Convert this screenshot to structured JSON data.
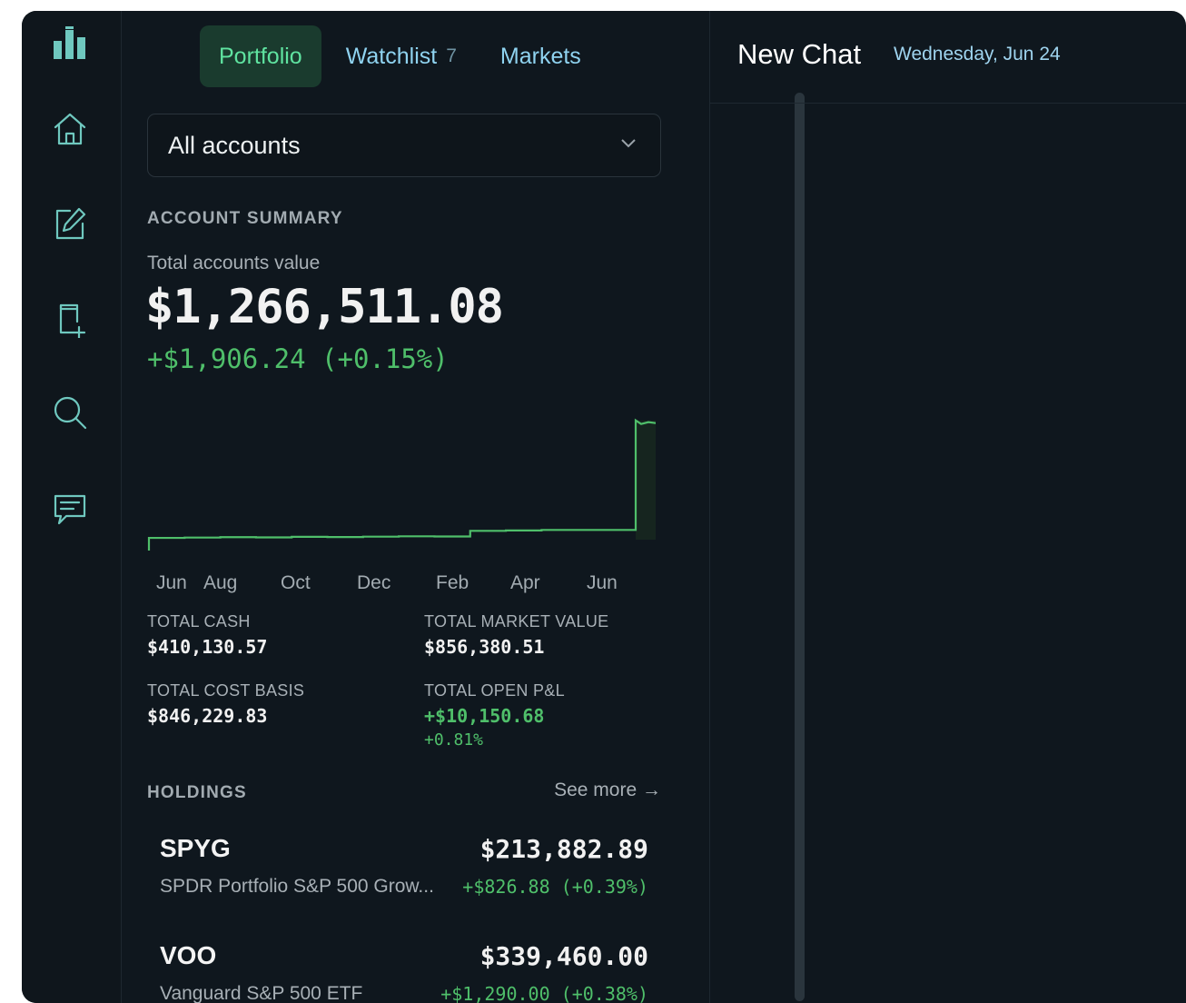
{
  "tabs": [
    {
      "label": "Portfolio",
      "count": "",
      "active": true
    },
    {
      "label": "Watchlist",
      "count": "7",
      "active": false
    },
    {
      "label": "Markets",
      "count": "",
      "active": false
    }
  ],
  "account_select": {
    "value": "All accounts"
  },
  "summary": {
    "title": "ACCOUNT SUMMARY",
    "total_label": "Total accounts value",
    "total_value": "$1,266,511.08",
    "total_change": "+$1,906.24 (+0.15%)"
  },
  "chart_data": {
    "type": "line",
    "x_ticks": [
      "Jun",
      "Aug",
      "Oct",
      "Dec",
      "Feb",
      "Apr",
      "Jun"
    ],
    "series": [
      {
        "values": [
          600000,
          602000,
          604000,
          603000,
          606000,
          605000,
          607000,
          609000,
          608000,
          640000,
          642000,
          645000,
          1266511
        ]
      }
    ],
    "color": "#4fbf6a"
  },
  "stats": {
    "total_cash_label": "TOTAL CASH",
    "total_cash": "$410,130.57",
    "total_market_value_label": "TOTAL MARKET VALUE",
    "total_market_value": "$856,380.51",
    "total_cost_basis_label": "TOTAL COST BASIS",
    "total_cost_basis": "$846,229.83",
    "total_open_pl_label": "TOTAL OPEN P&L",
    "total_open_pl": "+$10,150.68",
    "total_open_pl_pct": "+0.81%"
  },
  "holdings": {
    "title": "HOLDINGS",
    "see_more": "See more →",
    "items": [
      {
        "symbol": "SPYG",
        "price": "$213,882.89",
        "name": "SPDR Portfolio S&P 500 Grow...",
        "change": "+$826.88 (+0.39%)"
      },
      {
        "symbol": "VOO",
        "price": "$339,460.00",
        "name": "Vanguard S&P 500 ETF",
        "change": "+$1,290.00 (+0.38%)"
      }
    ]
  },
  "chat": {
    "title": "New Chat",
    "date": "Wednesday, Jun 24"
  },
  "sidebar_icons": [
    "logo-icon",
    "home-icon",
    "edit-icon",
    "add-document-icon",
    "search-icon",
    "chat-icon"
  ]
}
